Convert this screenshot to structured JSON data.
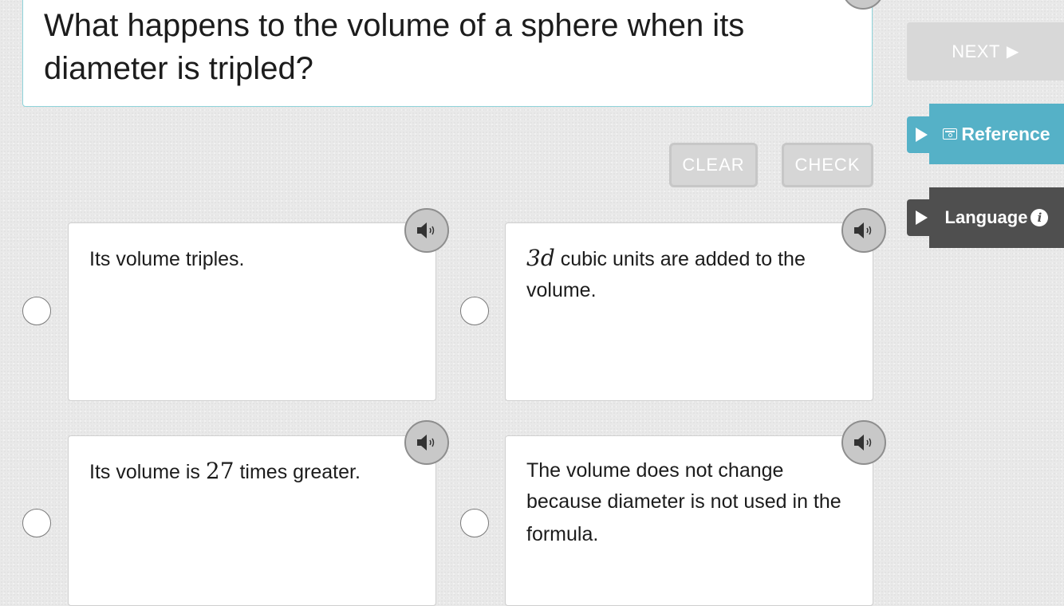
{
  "question": {
    "text": "What happens to the volume of a sphere when its diameter is tripled?"
  },
  "sidebar": {
    "next_label": "NEXT",
    "reference_label": "Reference",
    "language_label": "Language",
    "info_glyph": "i"
  },
  "actions": {
    "clear_label": "CLEAR",
    "check_label": "CHECK"
  },
  "options": [
    {
      "text_before": "Its volume triples.",
      "math": "",
      "text_after": ""
    },
    {
      "text_before": "",
      "math": "3d",
      "text_after": " cubic units are added to the volume."
    },
    {
      "text_before": "Its volume is ",
      "math": "27",
      "text_after": " times greater."
    },
    {
      "text_before": "The volume does not change because diameter is not used in the formula.",
      "math": "",
      "text_after": ""
    }
  ],
  "colors": {
    "accent_teal": "#55b1c7",
    "dark_panel": "#4f4f4f",
    "disabled_gray": "#d6d6d6"
  },
  "icons": [
    "speaker-icon",
    "play-icon",
    "reference-icon",
    "info-icon",
    "next-arrow-icon",
    "radio-button"
  ]
}
